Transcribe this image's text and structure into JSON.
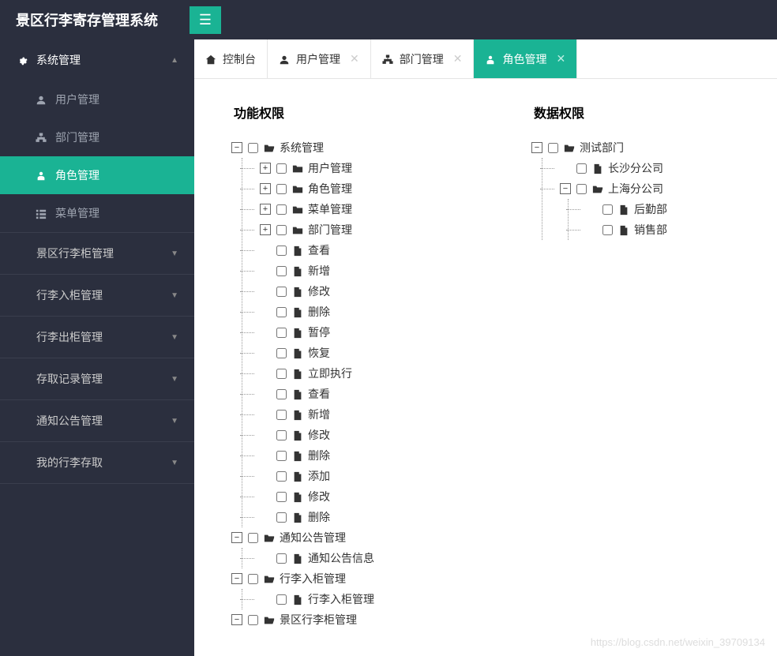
{
  "app_title": "景区行李寄存管理系统",
  "sidebar": {
    "groups": [
      {
        "label": "系统管理",
        "icon": "gear",
        "open": true,
        "items": [
          {
            "label": "用户管理",
            "icon": "user",
            "active": false
          },
          {
            "label": "部门管理",
            "icon": "sitemap",
            "active": false
          },
          {
            "label": "角色管理",
            "icon": "person",
            "active": true
          },
          {
            "label": "菜单管理",
            "icon": "list",
            "active": false
          }
        ]
      },
      {
        "label": "景区行李柜管理",
        "icon": "",
        "open": false,
        "items": []
      },
      {
        "label": "行李入柜管理",
        "icon": "",
        "open": false,
        "items": []
      },
      {
        "label": "行李出柜管理",
        "icon": "",
        "open": false,
        "items": []
      },
      {
        "label": "存取记录管理",
        "icon": "",
        "open": false,
        "items": []
      },
      {
        "label": "通知公告管理",
        "icon": "",
        "open": false,
        "items": []
      },
      {
        "label": "我的行李存取",
        "icon": "",
        "open": false,
        "items": []
      }
    ]
  },
  "tabs": [
    {
      "label": "控制台",
      "icon": "home",
      "closable": false,
      "active": false
    },
    {
      "label": "用户管理",
      "icon": "user",
      "closable": true,
      "active": false
    },
    {
      "label": "部门管理",
      "icon": "sitemap",
      "closable": true,
      "active": false
    },
    {
      "label": "角色管理",
      "icon": "person",
      "closable": true,
      "active": true
    }
  ],
  "panels": {
    "func": {
      "title": "功能权限"
    },
    "data": {
      "title": "数据权限"
    }
  },
  "func_tree": [
    {
      "label": "系统管理",
      "icon": "folder-open",
      "toggle": "-",
      "children": [
        {
          "label": "用户管理",
          "icon": "folder",
          "toggle": "+",
          "children": []
        },
        {
          "label": "角色管理",
          "icon": "folder",
          "toggle": "+",
          "children": []
        },
        {
          "label": "菜单管理",
          "icon": "folder",
          "toggle": "+",
          "children": []
        },
        {
          "label": "部门管理",
          "icon": "folder",
          "toggle": "+",
          "children": []
        },
        {
          "label": "查看",
          "icon": "file",
          "toggle": "",
          "children": []
        },
        {
          "label": "新增",
          "icon": "file",
          "toggle": "",
          "children": []
        },
        {
          "label": "修改",
          "icon": "file",
          "toggle": "",
          "children": []
        },
        {
          "label": "删除",
          "icon": "file",
          "toggle": "",
          "children": []
        },
        {
          "label": "暂停",
          "icon": "file",
          "toggle": "",
          "children": []
        },
        {
          "label": "恢复",
          "icon": "file",
          "toggle": "",
          "children": []
        },
        {
          "label": "立即执行",
          "icon": "file",
          "toggle": "",
          "children": []
        },
        {
          "label": "查看",
          "icon": "file",
          "toggle": "",
          "children": []
        },
        {
          "label": "新增",
          "icon": "file",
          "toggle": "",
          "children": []
        },
        {
          "label": "修改",
          "icon": "file",
          "toggle": "",
          "children": []
        },
        {
          "label": "删除",
          "icon": "file",
          "toggle": "",
          "children": []
        },
        {
          "label": "添加",
          "icon": "file",
          "toggle": "",
          "children": []
        },
        {
          "label": "修改",
          "icon": "file",
          "toggle": "",
          "children": []
        },
        {
          "label": "删除",
          "icon": "file",
          "toggle": "",
          "children": []
        }
      ]
    },
    {
      "label": "通知公告管理",
      "icon": "folder-open",
      "toggle": "-",
      "children": [
        {
          "label": "通知公告信息",
          "icon": "file",
          "toggle": "",
          "children": []
        }
      ]
    },
    {
      "label": "行李入柜管理",
      "icon": "folder-open",
      "toggle": "-",
      "children": [
        {
          "label": "行李入柜管理",
          "icon": "file",
          "toggle": "",
          "children": []
        }
      ]
    },
    {
      "label": "景区行李柜管理",
      "icon": "folder-open",
      "toggle": "-",
      "children": []
    }
  ],
  "data_tree": [
    {
      "label": "测试部门",
      "icon": "folder-open",
      "toggle": "-",
      "children": [
        {
          "label": "长沙分公司",
          "icon": "file",
          "toggle": "",
          "children": []
        },
        {
          "label": "上海分公司",
          "icon": "folder-open",
          "toggle": "-",
          "children": [
            {
              "label": "后勤部",
              "icon": "file",
              "toggle": "",
              "children": []
            },
            {
              "label": "销售部",
              "icon": "file",
              "toggle": "",
              "children": []
            }
          ]
        }
      ]
    }
  ],
  "watermark": "https://blog.csdn.net/weixin_39709134",
  "colors": {
    "accent": "#1ab394",
    "dark": "#2b2f3e"
  }
}
